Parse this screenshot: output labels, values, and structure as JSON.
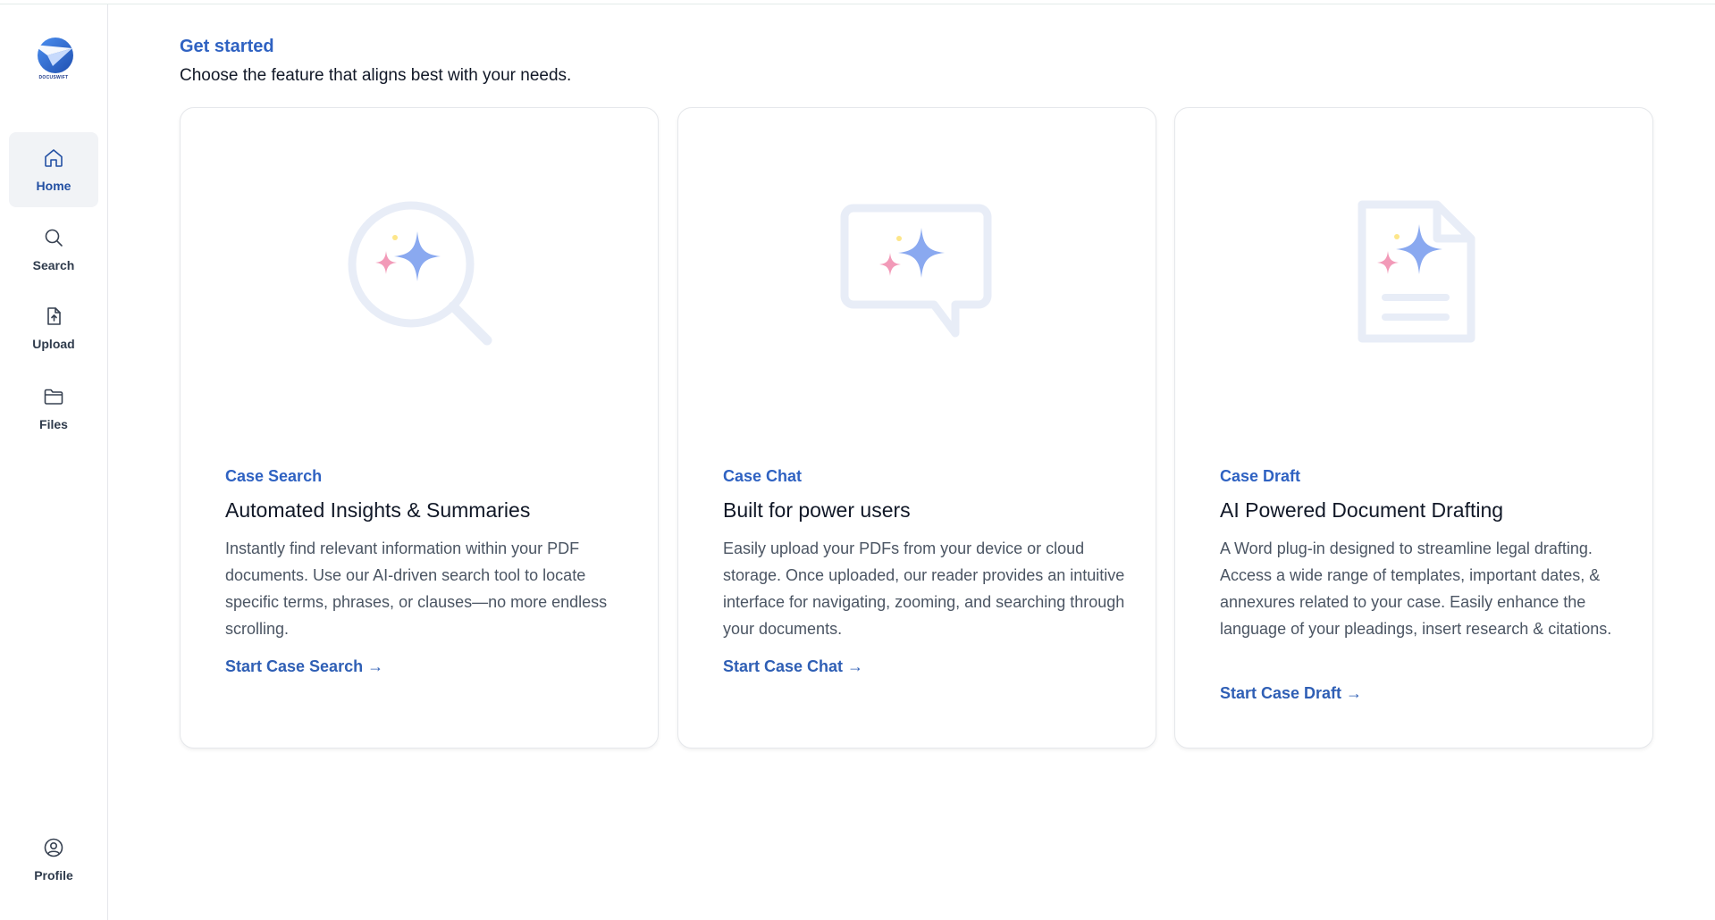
{
  "app": {
    "logo_text": "DOCUSWIFT",
    "accent_color": "#2f62c2"
  },
  "sidebar": {
    "items": [
      {
        "label": "Home",
        "icon": "home-icon",
        "active": true
      },
      {
        "label": "Search",
        "icon": "search-icon",
        "active": false
      },
      {
        "label": "Upload",
        "icon": "upload-file-icon",
        "active": false
      },
      {
        "label": "Files",
        "icon": "folder-icon",
        "active": false
      }
    ],
    "profile": {
      "label": "Profile",
      "icon": "user-circle-icon"
    }
  },
  "main": {
    "title": "Get started",
    "subtitle": "Choose the feature that aligns best with your needs.",
    "cards": [
      {
        "tag": "Case Search",
        "heading": "Automated Insights & Summaries",
        "description": "Instantly find relevant information within your PDF documents. Use our AI-driven search tool to locate specific terms, phrases, or clauses—no more endless scrolling.",
        "cta": "Start Case Search →",
        "icon": "magnifier-sparkle-icon"
      },
      {
        "tag": "Case Chat",
        "heading": "Built for power users",
        "description": "Easily upload your PDFs from your device or cloud storage. Once uploaded, our reader provides an intuitive interface for navigating, zooming, and searching through your documents.",
        "cta": "Start Case Chat →",
        "icon": "chat-sparkle-icon"
      },
      {
        "tag": "Case Draft",
        "heading": "AI Powered Document Drafting",
        "description": "A Word plug-in designed to streamline legal drafting. Access a wide range of templates, important dates, & annexures related to your case. Easily enhance the language of your pleadings, insert research & citations.",
        "cta": "Start Case Draft →",
        "icon": "document-sparkle-icon"
      }
    ]
  }
}
